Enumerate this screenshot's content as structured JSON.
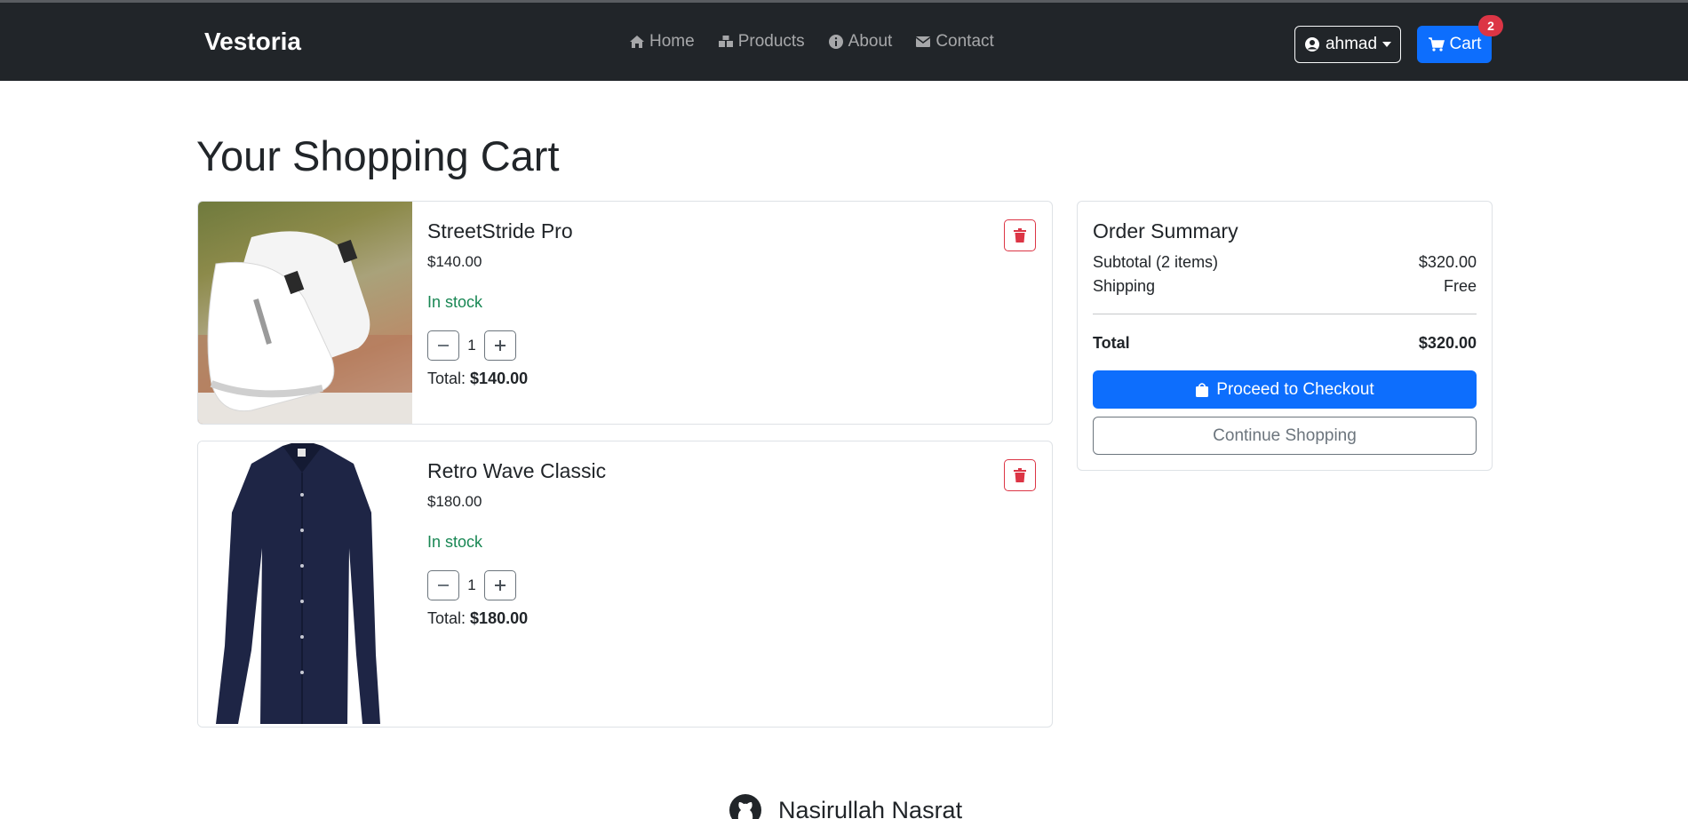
{
  "navbar": {
    "brand": "Vestoria",
    "links": [
      {
        "label": "Home",
        "icon": "home-icon"
      },
      {
        "label": "Products",
        "icon": "boxes-icon"
      },
      {
        "label": "About",
        "icon": "info-icon"
      },
      {
        "label": "Contact",
        "icon": "envelope-icon"
      }
    ],
    "user": {
      "name": "ahmad",
      "icon": "user-circle-icon"
    },
    "cart": {
      "label": "Cart",
      "count": "2",
      "icon": "cart-icon"
    }
  },
  "page": {
    "title": "Your Shopping Cart"
  },
  "cart_items": [
    {
      "name": "StreetStride Pro",
      "price": "$140.00",
      "stock": "In stock",
      "quantity": "1",
      "total_label": "Total:",
      "total": "$140.00",
      "image": "white-sneakers"
    },
    {
      "name": "Retro Wave Classic",
      "price": "$180.00",
      "stock": "In stock",
      "quantity": "1",
      "total_label": "Total:",
      "total": "$180.00",
      "image": "navy-shirt"
    }
  ],
  "summary": {
    "title": "Order Summary",
    "subtotal_label": "Subtotal (2 items)",
    "subtotal": "$320.00",
    "shipping_label": "Shipping",
    "shipping": "Free",
    "total_label": "Total",
    "total": "$320.00",
    "checkout_label": "Proceed to Checkout",
    "continue_label": "Continue Shopping"
  },
  "footer": {
    "author": "Nasirullah Nasrat",
    "icon": "github-icon"
  },
  "colors": {
    "primary": "#0d6efd",
    "danger": "#dc3545",
    "success": "#198754",
    "navbar": "#212529"
  }
}
